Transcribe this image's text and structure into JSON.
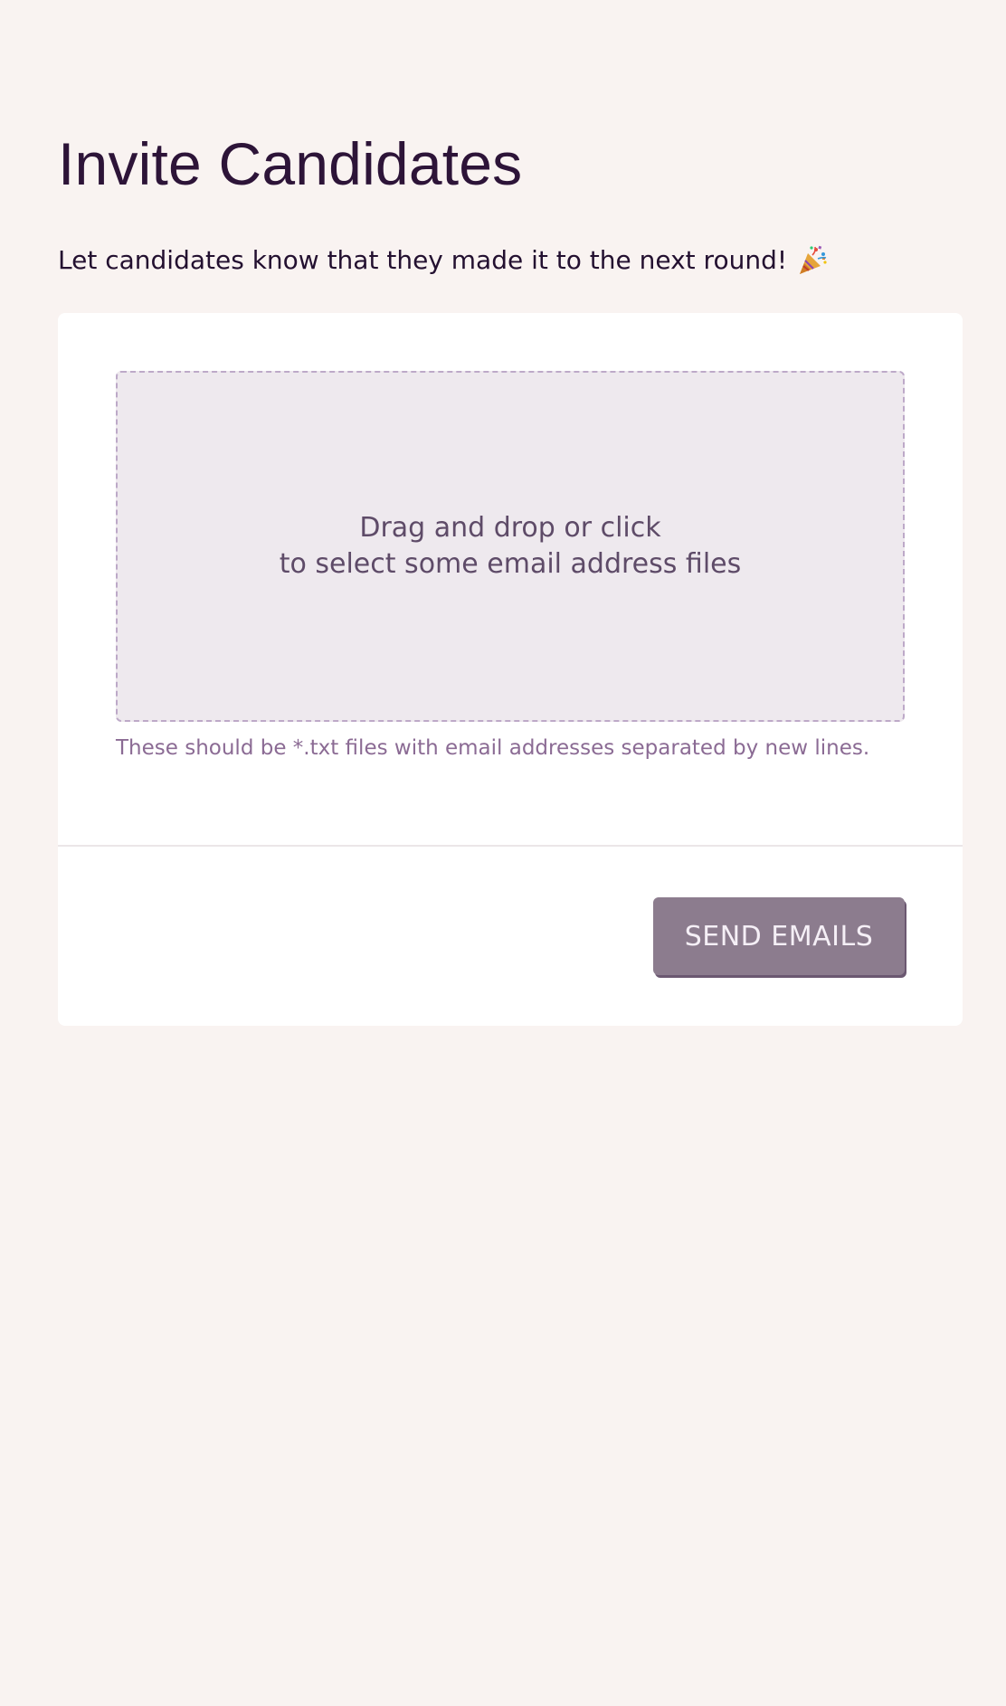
{
  "page": {
    "title": "Invite Candidates",
    "subtitle": "Let candidates know that they made it to the next round!",
    "subtitle_icon": "party-popper-icon"
  },
  "upload": {
    "dropzone_line1": "Drag and drop or click",
    "dropzone_line2": "to select some email address files",
    "hint": "These should be *.txt files with email addresses separated by new lines."
  },
  "actions": {
    "send_label": "SEND EMAILS"
  },
  "colors": {
    "background": "#f9f3f1",
    "card": "#ffffff",
    "title": "#2d1438",
    "dropzone_bg": "#eee9ee",
    "dropzone_border": "#bda9c8",
    "hint": "#8b6b94",
    "button_bg": "#8c7c8e",
    "button_text": "#f5eff6"
  }
}
